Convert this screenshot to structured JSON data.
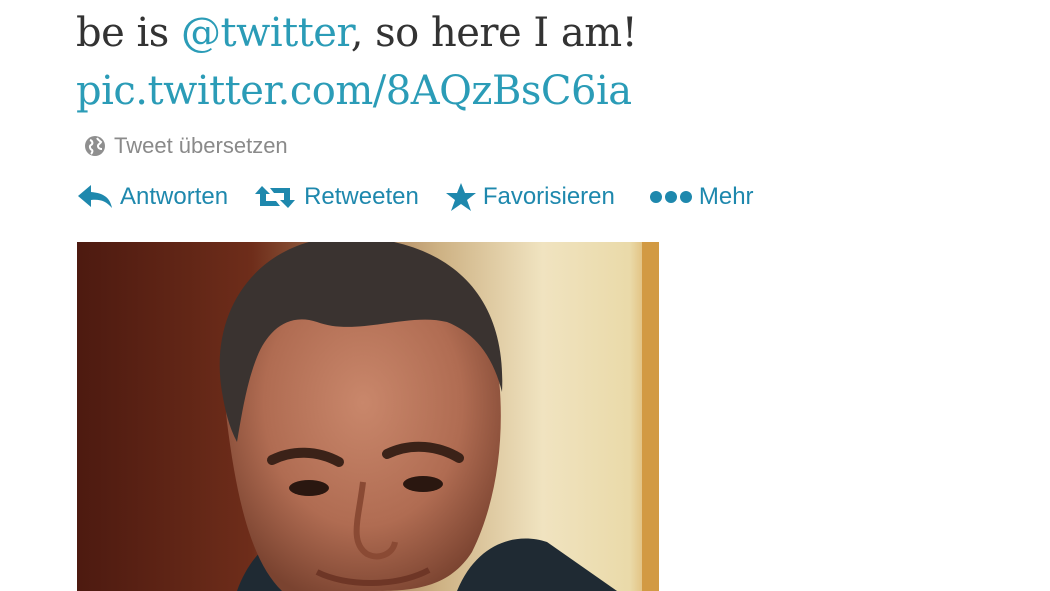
{
  "tweet": {
    "text_prefix": "be is ",
    "mention": "@twitter",
    "text_suffix": ", so here I am!",
    "link": "pic.twitter.com/8AQzBsC6ia"
  },
  "translate": {
    "label": "Tweet übersetzen",
    "icon": "globe-icon"
  },
  "actions": {
    "reply_label": "Antworten",
    "retweet_label": "Retweeten",
    "favorite_label": "Favorisieren",
    "more_label": "Mehr"
  },
  "colors": {
    "link": "#2b9cb7",
    "action": "#1e88ad",
    "text": "#333333",
    "muted": "#8a8a8a"
  }
}
